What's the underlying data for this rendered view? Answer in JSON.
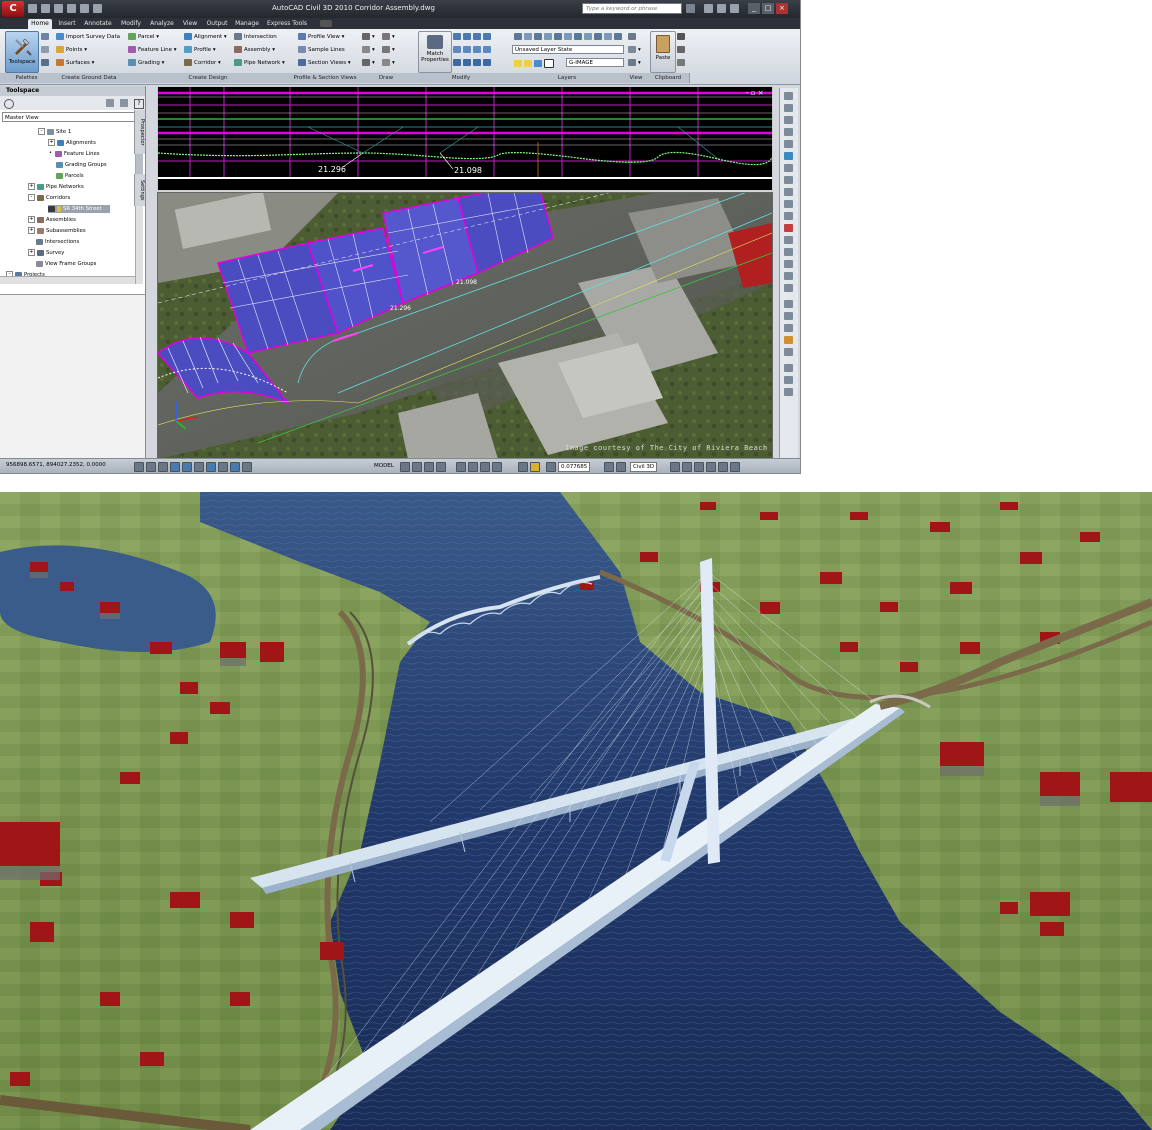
{
  "app": {
    "title": "AutoCAD Civil 3D 2010     Corridor Assembly.dwg",
    "search_placeholder": "Type a keyword or phrase",
    "accent": "#c0392b"
  },
  "tabs": [
    {
      "label": "Home",
      "active": true
    },
    {
      "label": "Insert"
    },
    {
      "label": "Annotate"
    },
    {
      "label": "Modify"
    },
    {
      "label": "Analyze"
    },
    {
      "label": "View"
    },
    {
      "label": "Output"
    },
    {
      "label": "Manage"
    },
    {
      "label": "Express Tools"
    }
  ],
  "ribbon": {
    "toolspace_label": "Toolspace",
    "ground": {
      "import_survey": "Import Survey Data",
      "points": "Points",
      "surfaces": "Surfaces",
      "parcel": "Parcel",
      "feature_line": "Feature Line",
      "grading": "Grading"
    },
    "design": {
      "alignment": "Alignment",
      "profile": "Profile",
      "corridor": "Corridor",
      "intersection": "Intersection",
      "assembly": "Assembly",
      "pipe_network": "Pipe Network"
    },
    "views": {
      "profile_view": "Profile View",
      "sample_lines": "Sample Lines",
      "section_views": "Section Views"
    },
    "match_properties": "Match Properties",
    "layer_state": "Unsaved Layer State",
    "layer_current": "G-IMAGE",
    "paste": "Paste",
    "panels": [
      "Palettes",
      "Create Ground Data",
      "Create Design",
      "Profile & Section Views",
      "Draw",
      "Modify",
      "Layers",
      "View",
      "Clipboard"
    ]
  },
  "toolspace": {
    "title": "Toolspace",
    "view_select": "Master View",
    "side_tabs": [
      "Prospector",
      "Settings"
    ],
    "tree": [
      {
        "label": "Site 1",
        "level": 2,
        "exp": "-"
      },
      {
        "label": "Alignments",
        "level": 3,
        "exp": "+"
      },
      {
        "label": "Feature Lines",
        "level": 3,
        "exp": "•"
      },
      {
        "label": "Grading Groups",
        "level": 3,
        "exp": ""
      },
      {
        "label": "Parcels",
        "level": 3,
        "exp": ""
      },
      {
        "label": "Pipe Networks",
        "level": 1,
        "exp": "+"
      },
      {
        "label": "Corridors",
        "level": 1,
        "exp": "-"
      },
      {
        "label": "SR 34th Street",
        "level": 2,
        "exp": "",
        "selected": true
      },
      {
        "label": "Assemblies",
        "level": 1,
        "exp": "+"
      },
      {
        "label": "Subassemblies",
        "level": 1,
        "exp": "+"
      },
      {
        "label": "Intersections",
        "level": 1,
        "exp": ""
      },
      {
        "label": "Survey",
        "level": 1,
        "exp": "+"
      },
      {
        "label": "View Frame Groups",
        "level": 1,
        "exp": ""
      },
      {
        "label": "Projects",
        "level": 0,
        "exp": "-"
      }
    ]
  },
  "profile": {
    "label_a": "21.296",
    "label_b": "21.098"
  },
  "plan": {
    "label_a": "21.098",
    "label_b": "21.296",
    "credit": "Image courtesy of The City of Riviera Beach"
  },
  "status": {
    "coords": "956898.6571, 894027.2352, 0.0000",
    "model": "MODEL",
    "scale": "0.077685",
    "workspace": "Civil 3D"
  }
}
